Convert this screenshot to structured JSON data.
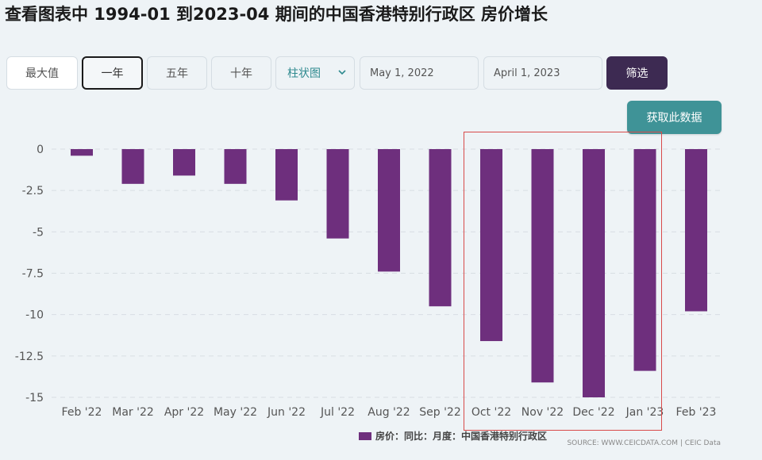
{
  "page": {
    "title": "查看图表中 1994-01 到2023-04 期间的中国香港特别行政区 房价增长"
  },
  "toolbar": {
    "max_label": "最大值",
    "one_year_label": "一年",
    "five_year_label": "五年",
    "ten_year_label": "十年",
    "chart_type_selected": "柱状图",
    "start_date": "May 1, 2022",
    "end_date": "April 1, 2023",
    "filter_label": "筛选",
    "fetch_label": "获取此数据"
  },
  "colors": {
    "bar": "#6e2f7d",
    "filter_button": "#3d2a52",
    "fetch_button": "#3f9397",
    "highlight_box": "#d84a4a"
  },
  "chart_data": {
    "type": "bar",
    "categories": [
      "Feb '22",
      "Mar '22",
      "Apr '22",
      "May '22",
      "Jun '22",
      "Jul '22",
      "Aug '22",
      "Sep '22",
      "Oct '22",
      "Nov '22",
      "Dec '22",
      "Jan '23",
      "Feb '23"
    ],
    "series": [
      {
        "name": "房价：同比：月度：中国香港特别行政区",
        "values": [
          -0.4,
          -2.1,
          -1.6,
          -2.1,
          -3.1,
          -5.4,
          -7.4,
          -9.5,
          -11.6,
          -14.1,
          -15.0,
          -13.4,
          -9.8
        ]
      }
    ],
    "yticks": [
      "0",
      "-2.5",
      "-5",
      "-7.5",
      "-10",
      "-12.5",
      "-15"
    ],
    "ylim": [
      -15,
      0
    ],
    "grid": "horizontal-dashed",
    "legend_position": "bottom",
    "source": "SOURCE: WWW.CEICDATA.COM | CEIC Data"
  }
}
